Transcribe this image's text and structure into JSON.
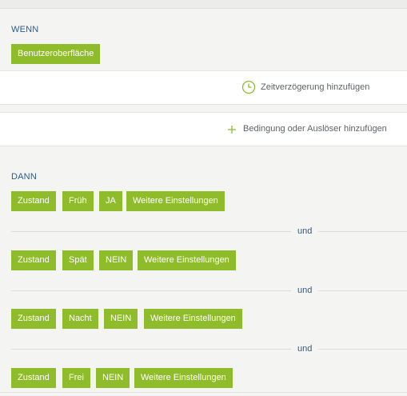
{
  "colors": {
    "accent": "#8fbc2b",
    "label_blue": "#2d5b8a"
  },
  "wenn": {
    "label": "WENN",
    "trigger_chip": "Benutzeroberfläche"
  },
  "delay": {
    "label": "Zeitverzögerung hinzufügen",
    "icon": "clock-icon"
  },
  "condition": {
    "label": "Bedingung oder Auslöser hinzufügen",
    "icon": "plus-icon"
  },
  "dann": {
    "label": "DANN",
    "connector": "und",
    "rows": [
      {
        "type": "Zustand",
        "value": "Früh",
        "state": "JA",
        "more": "Weitere Einstellungen"
      },
      {
        "type": "Zustand",
        "value": "Spät",
        "state": "NEIN",
        "more": "Weitere Einstellungen"
      },
      {
        "type": "Zustand",
        "value": "Nacht",
        "state": "NEIN",
        "more": "Weitere Einstellungen"
      },
      {
        "type": "Zustand",
        "value": "Frei",
        "state": "NEIN",
        "more": "Weitere Einstellungen"
      }
    ]
  }
}
